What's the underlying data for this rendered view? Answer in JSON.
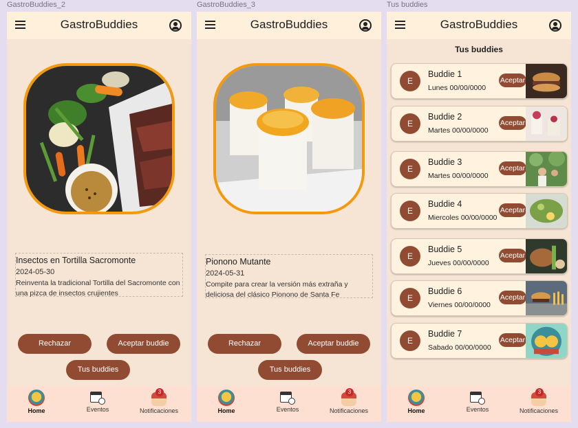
{
  "frames": [
    {
      "title": "GastroBuddies_2"
    },
    {
      "title": "GastroBuddies_3"
    },
    {
      "title": "Tus buddies"
    }
  ],
  "app_title": "GastroBuddies",
  "screen1": {
    "card": {
      "name": "Insectos en Tortilla Sacromonte",
      "date": "2024-05-30",
      "desc": "Reinventa la tradicional Tortilla del Sacromonte con una pizca de insectos crujientes"
    },
    "reject_label": "Rechazar",
    "accept_label": "Aceptar buddie",
    "buddies_label": "Tus buddies"
  },
  "screen2": {
    "card": {
      "name": "Pionono Mutante",
      "date": "2024-05-31",
      "desc": "Compite para crear la versión más extraña y deliciosa del clásico Pionono de Santa Fe"
    },
    "reject_label": "Rechazar",
    "accept_label": "Aceptar buddie",
    "buddies_label": "Tus buddies"
  },
  "screen3": {
    "heading": "Tus buddies",
    "buddies": [
      {
        "initial": "E",
        "name": "Buddie 1",
        "date": "Lunes 00/00/0000",
        "accept": "Aceptar"
      },
      {
        "initial": "E",
        "name": "Buddie 2",
        "date": "Martes 00/00/0000",
        "accept": "Aceptar"
      },
      {
        "initial": "E",
        "name": "Buddie 3",
        "date": "Martes 00/00/0000",
        "accept": "Aceptar"
      },
      {
        "initial": "E",
        "name": "Buddie 4",
        "date": "Miercoles 00/00/0000",
        "accept": "Aceptar"
      },
      {
        "initial": "E",
        "name": "Buddie 5",
        "date": "Jueves 00/00/0000",
        "accept": "Aceptar"
      },
      {
        "initial": "E",
        "name": "Buddie 6",
        "date": "Viernes 00/00/0000",
        "accept": "Aceptar"
      },
      {
        "initial": "E",
        "name": "Buddie 7",
        "date": "Sabado 00/00/0000",
        "accept": "Aceptar"
      }
    ]
  },
  "nav": {
    "home": "Home",
    "events": "Eventos",
    "notifications": "Notificaciones",
    "badge_count": "3"
  },
  "colors": {
    "primary": "#904b32",
    "accent": "#f5990c",
    "background": "#f6e5d5",
    "appbar": "#fff0dc",
    "bottomnav": "#fde0d2"
  }
}
